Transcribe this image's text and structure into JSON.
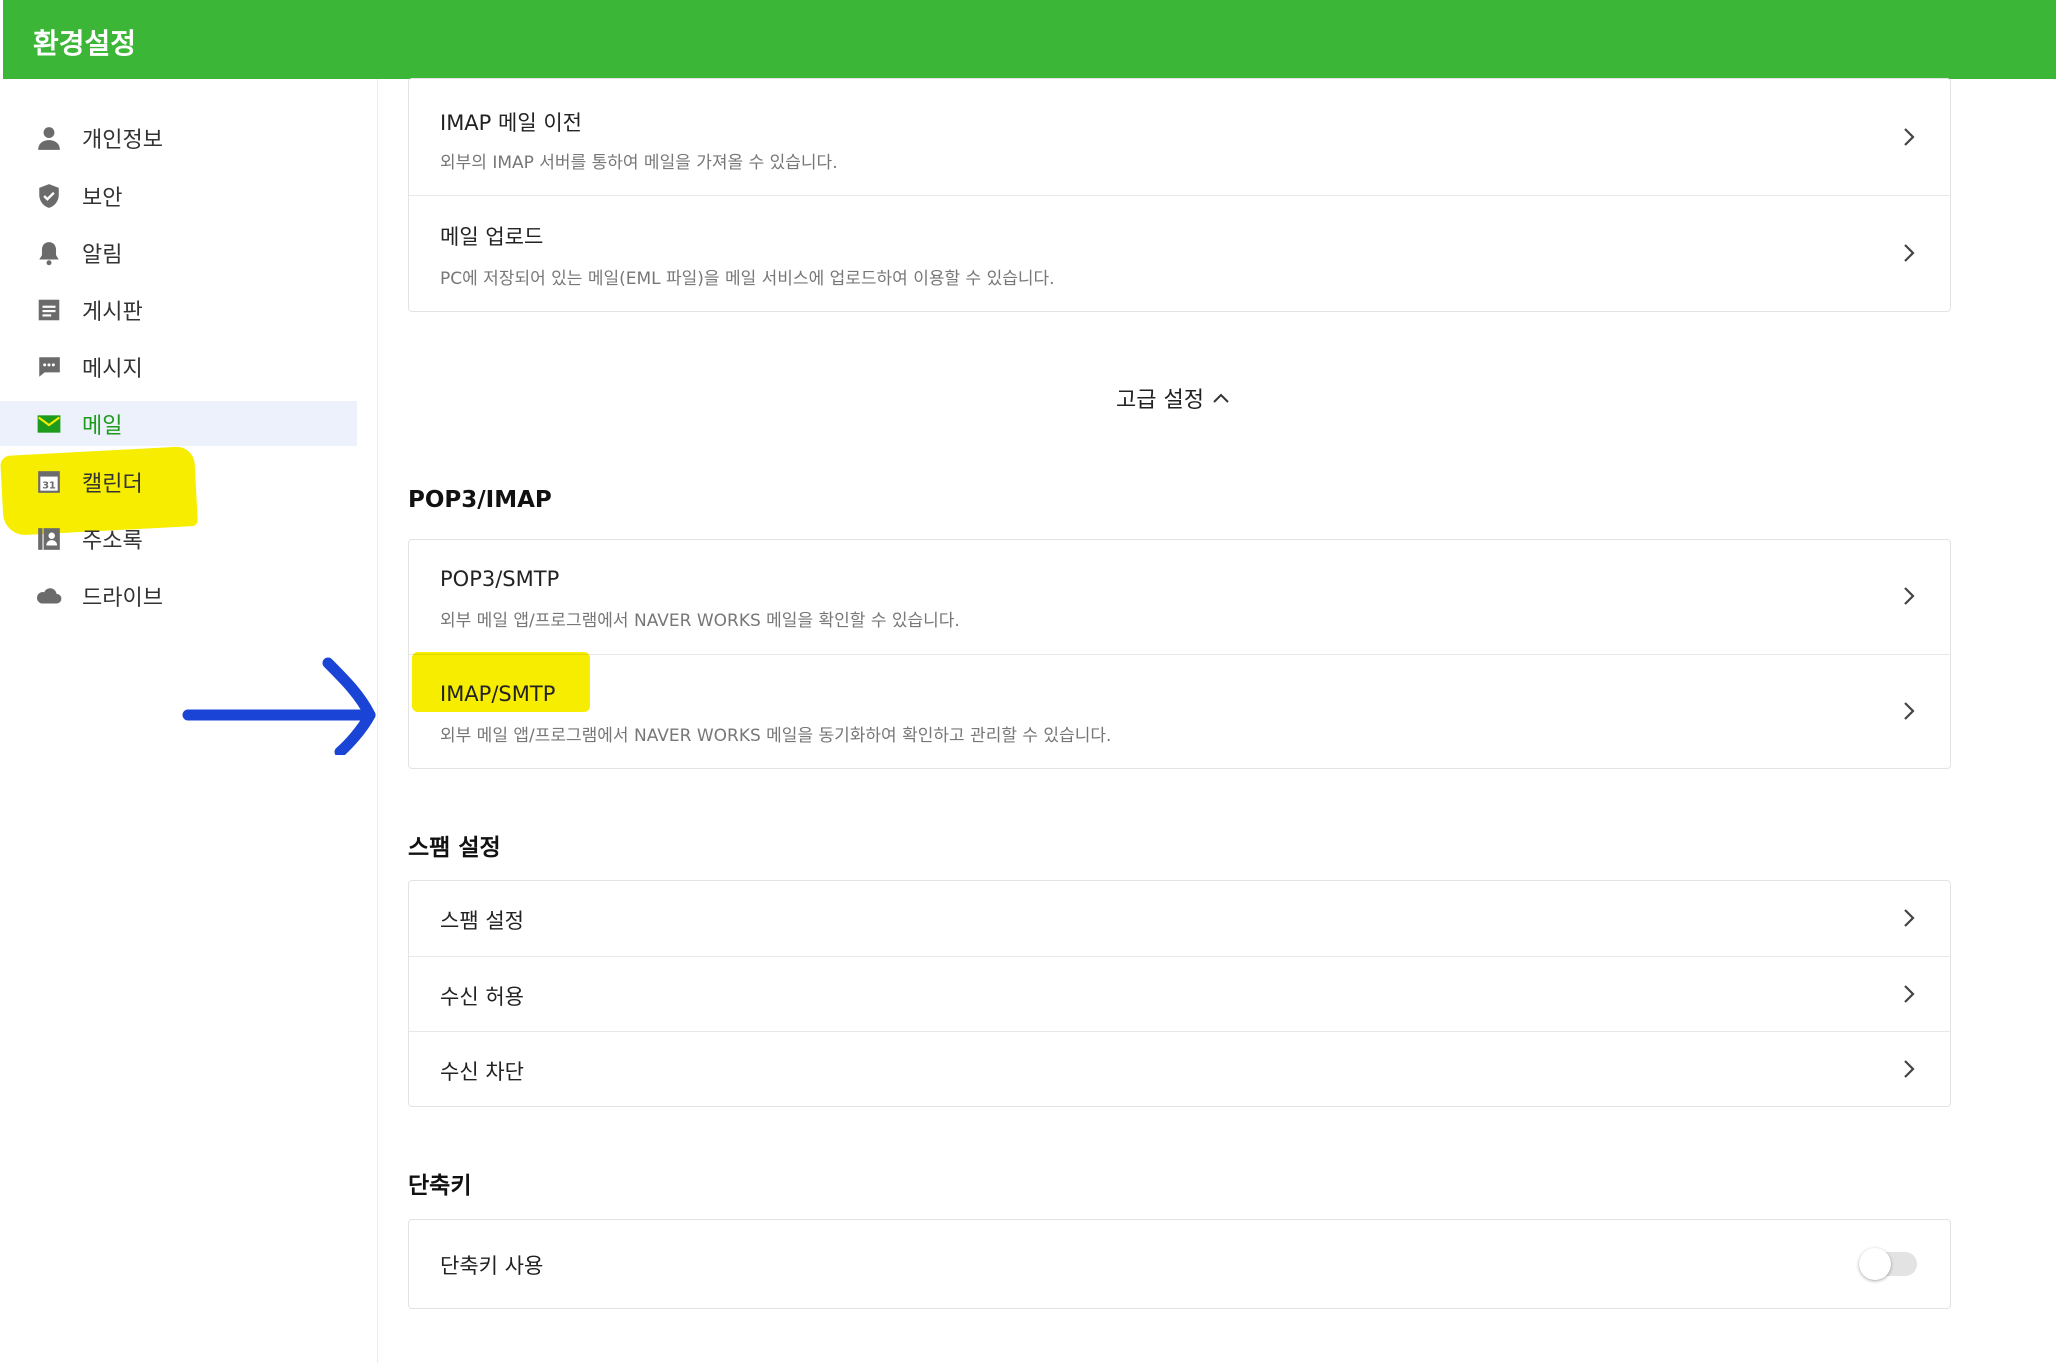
{
  "header": {
    "title": "환경설정",
    "color": "#3cb637"
  },
  "sidebar": {
    "items": [
      {
        "label": "개인정보",
        "icon": "person-icon"
      },
      {
        "label": "보안",
        "icon": "shield-icon"
      },
      {
        "label": "알림",
        "icon": "bell-icon"
      },
      {
        "label": "게시판",
        "icon": "board-icon"
      },
      {
        "label": "메시지",
        "icon": "message-icon"
      },
      {
        "label": "메일",
        "icon": "mail-icon",
        "active": true
      },
      {
        "label": "캘린더",
        "icon": "calendar-icon",
        "icon_text": "31"
      },
      {
        "label": "주소록",
        "icon": "contacts-icon"
      },
      {
        "label": "드라이브",
        "icon": "cloud-icon"
      }
    ]
  },
  "import_card": {
    "rows": [
      {
        "title": "IMAP 메일 이전",
        "desc": "외부의 IMAP 서버를 통하여 메일을 가져올 수 있습니다."
      },
      {
        "title": "메일 업로드",
        "desc": "PC에 저장되어 있는 메일(EML 파일)을 메일 서비스에 업로드하여 이용할 수 있습니다."
      }
    ]
  },
  "advanced": {
    "label": "고급 설정"
  },
  "pop3": {
    "title": "POP3/IMAP",
    "rows": [
      {
        "title": "POP3/SMTP",
        "desc": "외부 메일 앱/프로그램에서 NAVER WORKS 메일을 확인할 수 있습니다."
      },
      {
        "title": "IMAP/SMTP",
        "desc": "외부 메일 앱/프로그램에서 NAVER WORKS 메일을 동기화하여 확인하고 관리할 수 있습니다."
      }
    ]
  },
  "spam": {
    "title": "스팸 설정",
    "rows": [
      {
        "title": "스팸 설정"
      },
      {
        "title": "수신 허용"
      },
      {
        "title": "수신 차단"
      }
    ]
  },
  "shortcut": {
    "title": "단축키",
    "row_label": "단축키 사용",
    "enabled": false
  },
  "annotations": {
    "highlight_color": "#f7ed00",
    "arrow_color": "#1a44d6"
  }
}
